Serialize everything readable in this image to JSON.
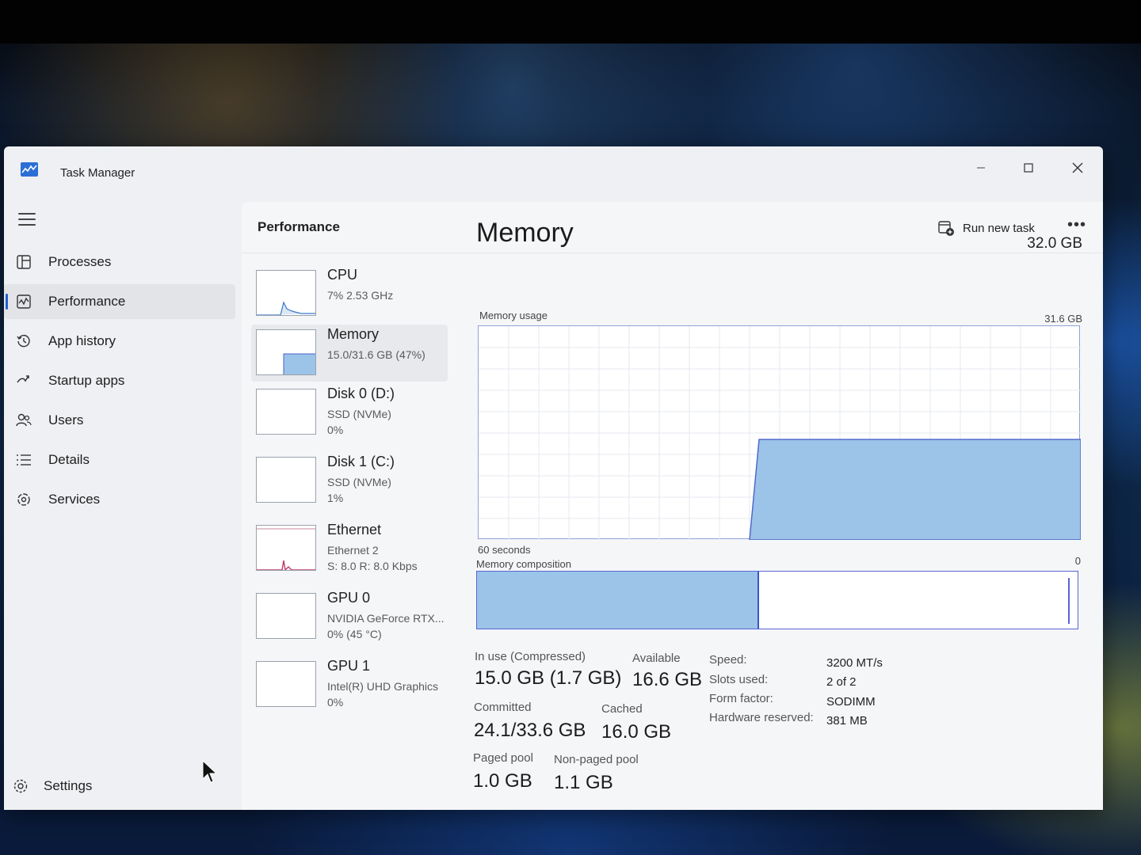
{
  "window": {
    "title": "Task Manager"
  },
  "colors": {
    "accent": "#1f5fd1",
    "memory_fill": "#9cc3e8",
    "memory_line": "#4a63c9"
  },
  "sidebar": {
    "items": [
      {
        "label": "Processes",
        "icon": "processes-icon"
      },
      {
        "label": "Performance",
        "icon": "performance-icon",
        "active": true
      },
      {
        "label": "App history",
        "icon": "history-icon"
      },
      {
        "label": "Startup apps",
        "icon": "startup-icon"
      },
      {
        "label": "Users",
        "icon": "users-icon"
      },
      {
        "label": "Details",
        "icon": "details-icon"
      },
      {
        "label": "Services",
        "icon": "services-icon"
      }
    ],
    "settings_label": "Settings"
  },
  "main": {
    "title": "Performance",
    "run_new_task": "Run new task",
    "more": "•••"
  },
  "resources": [
    {
      "name": "CPU",
      "sub1": "7%  2.53 GHz",
      "sub2": ""
    },
    {
      "name": "Memory",
      "sub1": "15.0/31.6 GB (47%)",
      "sub2": ""
    },
    {
      "name": "Disk 0 (D:)",
      "sub1": "SSD (NVMe)",
      "sub2": "0%"
    },
    {
      "name": "Disk 1 (C:)",
      "sub1": "SSD (NVMe)",
      "sub2": "1%"
    },
    {
      "name": "Ethernet",
      "sub1": "Ethernet 2",
      "sub2": "S: 8.0  R: 8.0 Kbps"
    },
    {
      "name": "GPU 0",
      "sub1": "NVIDIA GeForce RTX...",
      "sub2": "0%  (45 °C)"
    },
    {
      "name": "GPU 1",
      "sub1": "Intel(R) UHD Graphics",
      "sub2": "0%"
    }
  ],
  "detail": {
    "title": "Memory",
    "total": "32.0 GB",
    "usage_label": "Memory usage",
    "usage_max": "31.6 GB",
    "time_label": "60 seconds",
    "zero_label": "0",
    "composition_label": "Memory composition",
    "in_use_fraction": 0.47,
    "stats": {
      "in_use_label": "In use (Compressed)",
      "in_use_value": "15.0 GB (1.7 GB)",
      "available_label": "Available",
      "available_value": "16.6 GB",
      "committed_label": "Committed",
      "committed_value": "24.1/33.6 GB",
      "cached_label": "Cached",
      "cached_value": "16.0 GB",
      "paged_label": "Paged pool",
      "paged_value": "1.0 GB",
      "nonpaged_label": "Non-paged pool",
      "nonpaged_value": "1.1 GB"
    },
    "props": [
      {
        "label": "Speed:",
        "value": "3200 MT/s"
      },
      {
        "label": "Slots used:",
        "value": "2 of 2"
      },
      {
        "label": "Form factor:",
        "value": "SODIMM"
      },
      {
        "label": "Hardware reserved:",
        "value": "381 MB"
      }
    ]
  }
}
